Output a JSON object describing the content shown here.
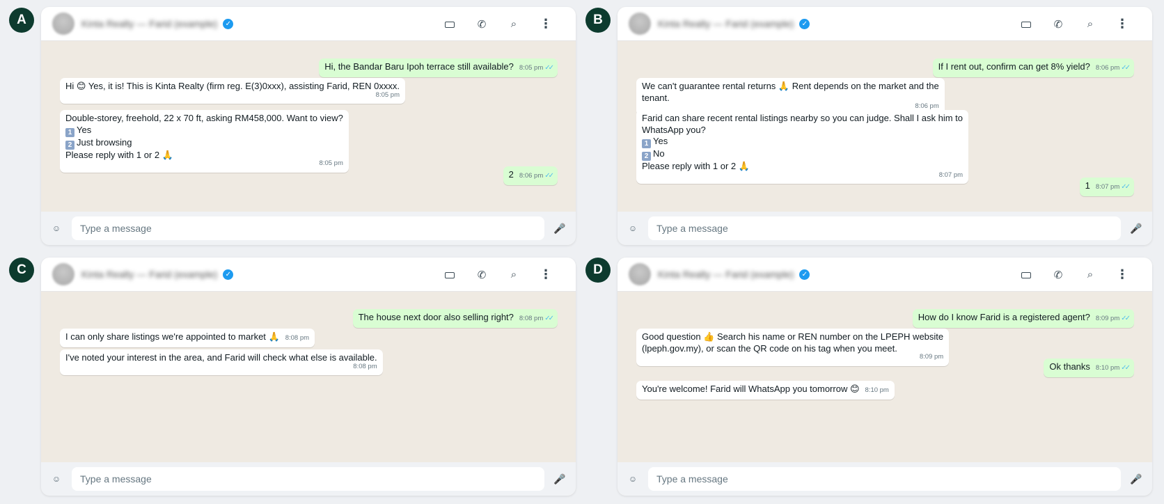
{
  "panels": [
    {
      "label": "A",
      "header": {
        "contact_name": "Kinta Realty — Farid (example)",
        "verified_glyph": "✓"
      },
      "composer": {
        "placeholder": "Type a message"
      },
      "messages": [
        {
          "dir": "out",
          "lines": [
            "Hi, the Bandar Baru Ipoh terrace still available?"
          ],
          "time": "8:05 pm",
          "ticks": "✓✓"
        },
        {
          "dir": "in",
          "lines": [
            "Hi 😊 Yes, it is! This is Kinta Realty (firm reg. E(3)0xxx), assisting Farid, REN 0xxxx."
          ],
          "time": "8:05 pm"
        },
        {
          "dir": "in",
          "lines": [
            "Double-storey, freehold, 22 x 70 ft, asking RM458,000. Want to view?",
            "1️⃣ Yes",
            "2️⃣ Just browsing",
            "Please reply with 1 or 2 🙏"
          ],
          "time": "8:05 pm"
        },
        {
          "dir": "out",
          "lines": [
            "2"
          ],
          "time": "8:06 pm",
          "ticks": "✓✓"
        }
      ]
    },
    {
      "label": "B",
      "header": {
        "contact_name": "Kinta Realty — Farid (example)",
        "verified_glyph": "✓"
      },
      "composer": {
        "placeholder": "Type a message"
      },
      "messages": [
        {
          "dir": "out",
          "lines": [
            "If I rent out, confirm can get 8% yield?"
          ],
          "time": "8:06 pm",
          "ticks": "✓✓"
        },
        {
          "dir": "in",
          "lines": [
            "We can't guarantee rental returns 🙏 Rent depends on the market and the",
            "tenant."
          ],
          "time": "8:06 pm"
        },
        {
          "dir": "in",
          "lines": [
            "Farid can share recent rental listings nearby so you can judge. Shall I ask him to",
            "WhatsApp you?",
            "1️⃣ Yes",
            "2️⃣ No",
            "Please reply with 1 or 2 🙏"
          ],
          "time": "8:07 pm"
        },
        {
          "dir": "out",
          "lines": [
            "1"
          ],
          "time": "8:07 pm",
          "ticks": "✓✓"
        }
      ]
    },
    {
      "label": "C",
      "header": {
        "contact_name": "Kinta Realty — Farid (example)",
        "verified_glyph": "✓"
      },
      "composer": {
        "placeholder": "Type a message"
      },
      "messages": [
        {
          "dir": "out",
          "lines": [
            "The house next door also selling right?"
          ],
          "time": "8:08 pm",
          "ticks": "✓✓"
        },
        {
          "dir": "in",
          "lines": [
            "I can only share listings we're appointed to market 🙏"
          ],
          "time": "8:08 pm"
        },
        {
          "dir": "in",
          "lines": [
            "I've noted your interest in the area, and Farid will check what else is available."
          ],
          "time": "8:08 pm"
        }
      ]
    },
    {
      "label": "D",
      "header": {
        "contact_name": "Kinta Realty — Farid (example)",
        "verified_glyph": "✓"
      },
      "composer": {
        "placeholder": "Type a message"
      },
      "messages": [
        {
          "dir": "out",
          "lines": [
            "How do I know Farid is a registered agent?"
          ],
          "time": "8:09 pm",
          "ticks": "✓✓"
        },
        {
          "dir": "in",
          "lines": [
            "Good question 👍 Search his name or REN number on the LPEPH website",
            "(lpeph.gov.my), or scan the QR code on his tag when you meet."
          ],
          "time": "8:09 pm"
        },
        {
          "dir": "out",
          "lines": [
            "Ok thanks"
          ],
          "time": "8:10 pm",
          "ticks": "✓✓"
        },
        {
          "dir": "in",
          "lines": [
            "You're welcome! Farid will WhatsApp you tomorrow 😊"
          ],
          "time": "8:10 pm"
        }
      ]
    }
  ],
  "icons": {
    "video": "video-icon",
    "call": "phone-icon",
    "search": "search-icon",
    "menu": "more-vertical-icon",
    "emoji": "emoji-icon",
    "mic": "mic-icon"
  },
  "icon_glyphs": {
    "call": "✆",
    "search": "⌕",
    "menu": "⋮",
    "emoji": "☺",
    "mic": "🎤"
  },
  "colors": {
    "label_badge": "#0d3b2e",
    "chat_bg": "#efeae2",
    "outgoing_bubble": "#d9fdd3",
    "incoming_bubble": "#ffffff",
    "verified": "#1d9bf0",
    "read_ticks": "#53bdeb"
  }
}
